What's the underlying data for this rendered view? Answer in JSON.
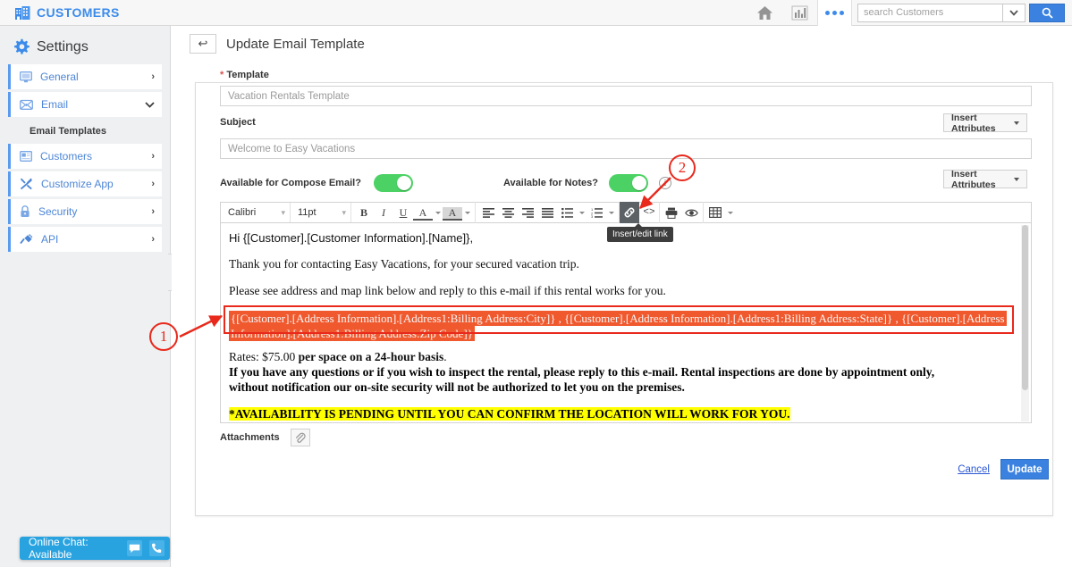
{
  "header": {
    "brand": "CUSTOMERS",
    "brand_color": "#3b8beb",
    "icons": [
      "home-icon",
      "chart-icon",
      "more-icon"
    ],
    "search": {
      "placeholder": "search Customers",
      "value": ""
    }
  },
  "sidebar": {
    "title": "Settings",
    "items": [
      {
        "label": "General",
        "icon": "monitor-icon",
        "chevron": "›",
        "expanded": false
      },
      {
        "label": "Email",
        "icon": "envelope-icon",
        "chevron": "⌄",
        "expanded": true
      }
    ],
    "sub_label": "Email Templates",
    "items2": [
      {
        "label": "Customers",
        "icon": "card-icon",
        "chevron": "›"
      },
      {
        "label": "Customize App",
        "icon": "tools-icon",
        "chevron": "›"
      },
      {
        "label": "Security",
        "icon": "lock-icon",
        "chevron": "›"
      },
      {
        "label": "API",
        "icon": "plug-icon",
        "chevron": "›"
      }
    ],
    "collapse": "‹"
  },
  "chat": {
    "label": "Online Chat: Available"
  },
  "page": {
    "title": "Update Email Template",
    "back": "↩"
  },
  "form": {
    "template_label": "Template",
    "template_required": "*",
    "template_value": "Vacation Rentals Template",
    "subject_label": "Subject",
    "subject_value": "Welcome to Easy Vacations",
    "insert_attributes_1": "Insert Attributes",
    "insert_attributes_2": "Insert Attributes",
    "compose_label": "Available for Compose Email?",
    "compose_state": "on",
    "notes_label": "Available for Notes?",
    "notes_state": "on",
    "info_icon": "i",
    "attachments_label": "Attachments",
    "cancel_label": "Cancel",
    "update_label": "Update"
  },
  "editor": {
    "font_name": "Calibri",
    "font_size": "11pt",
    "tooltip": "Insert/edit link",
    "buttons": {
      "bold": "B",
      "italic": "I",
      "underline": "U",
      "text_color": "A",
      "highlight": "A",
      "align_left": "align-left-icon",
      "align_center": "align-center-icon",
      "align_right": "align-right-icon",
      "align_justify": "align-justify-icon",
      "bullet_list": "bullet-list-icon",
      "numbered_list": "numbered-list-icon",
      "link": "link-icon",
      "source_code": "<>",
      "print": "print-icon",
      "preview": "eye-icon",
      "table": "table-icon"
    }
  },
  "body_content": {
    "greeting": "Hi {[Customer].[Customer Information].[Name]},",
    "p1": "Thank you for contacting Easy Vacations, for your secured vacation trip.",
    "p2": "Please see address and map link below and reply to this e-mail if this rental works for you.",
    "address_selected": "{[Customer].[Address Information].[Address1:Billing Address:City]} , {[Customer].[Address Information].[Address1:Billing Address:State]} , {[Customer].[Address Information].[Address1:Billing Address:Zip Code]}",
    "rates_prefix": "Rates: $75.00 ",
    "rates_bold": "per space on a 24-hour basis",
    "rates_suffix": ".",
    "notice_line1": "If you have any questions or if you wish to inspect the rental, please reply to this e-mail. Rental inspections are done by appointment only,",
    "notice_line2": "without notification our on-site security will not be authorized to let you on the premises.",
    "availability": "*AVAILABILITY IS PENDING UNTIL YOU CAN CONFIRM THE LOCATION WILL WORK FOR YOU.",
    "availability_period": "."
  },
  "annotations": {
    "marker_1": "1",
    "marker_2": "2",
    "color": "#e8291c"
  }
}
